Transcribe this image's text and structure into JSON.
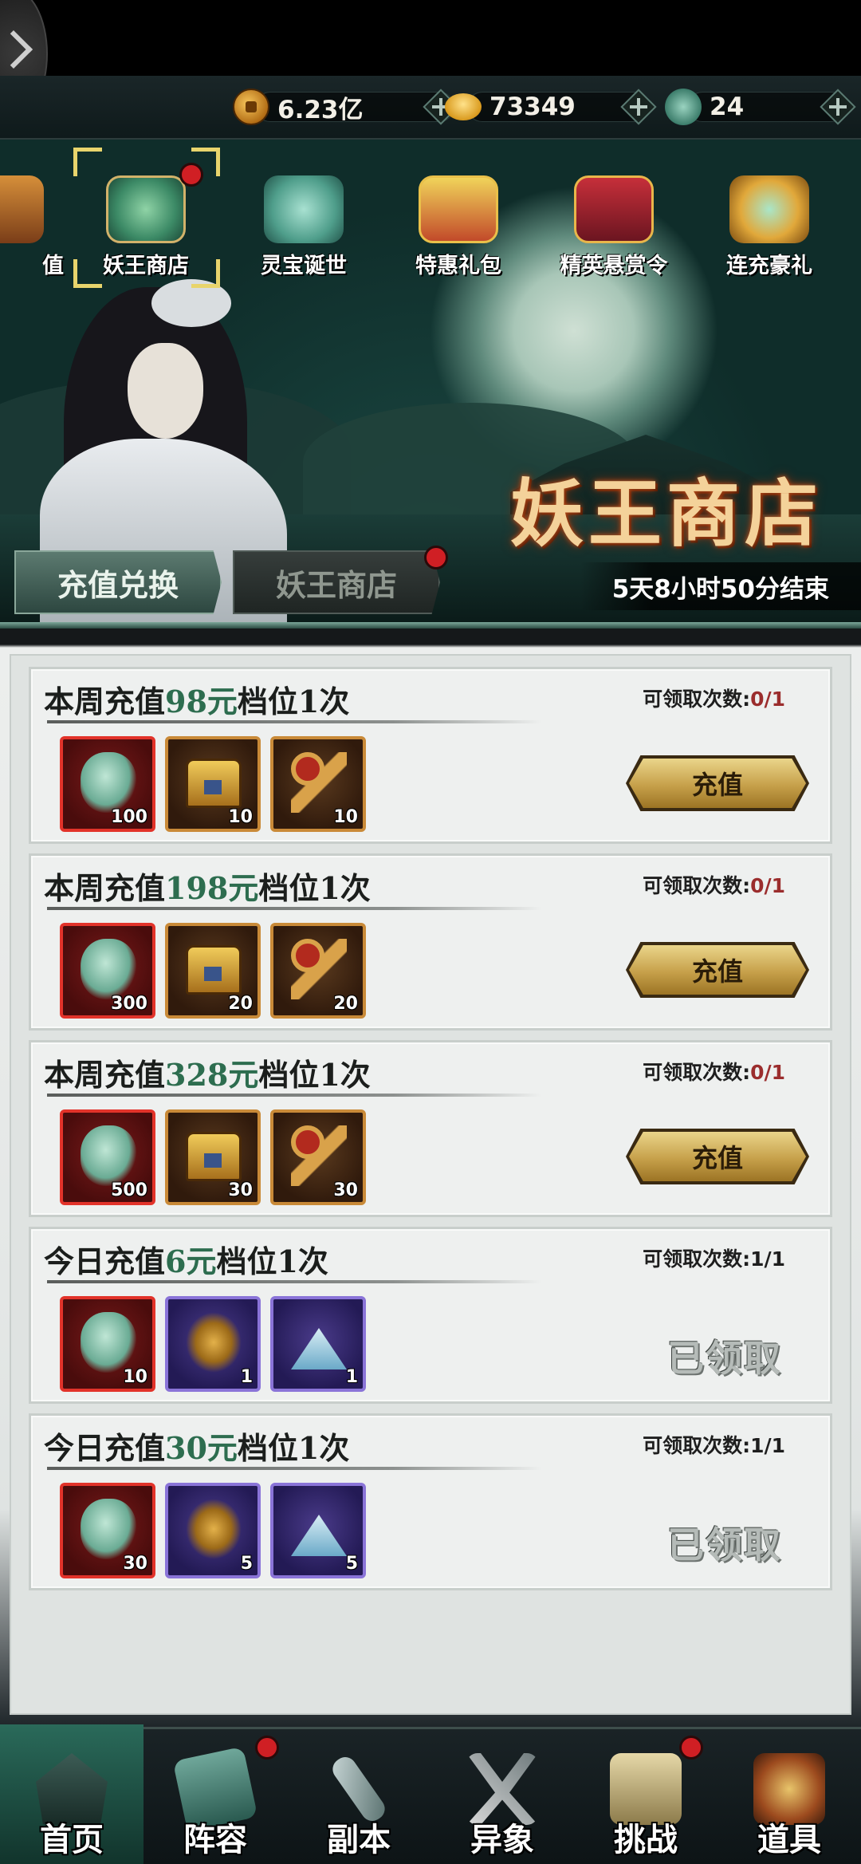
{
  "currency": {
    "gold": "6.23亿",
    "ingot": "73349",
    "jade": "24"
  },
  "shop_icons": [
    {
      "label": "值"
    },
    {
      "label": "妖王商店"
    },
    {
      "label": "灵宝诞世"
    },
    {
      "label": "特惠礼包"
    },
    {
      "label": "精英悬赏令"
    },
    {
      "label": "连充豪礼"
    }
  ],
  "banner": {
    "title": "妖王商店",
    "timer": "5天8小时50分结束"
  },
  "tabs": [
    {
      "label": "充值兑换"
    },
    {
      "label": "妖王商店"
    }
  ],
  "cards": [
    {
      "prefix": "本周充值",
      "amount": "98元",
      "suffix": "档位1次",
      "count_label": "可领取次数:",
      "count": "0/1",
      "rewards": [
        "100",
        "10",
        "10"
      ],
      "action": "充值"
    },
    {
      "prefix": "本周充值",
      "amount": "198元",
      "suffix": "档位1次",
      "count_label": "可领取次数:",
      "count": "0/1",
      "rewards": [
        "300",
        "20",
        "20"
      ],
      "action": "充值"
    },
    {
      "prefix": "本周充值",
      "amount": "328元",
      "suffix": "档位1次",
      "count_label": "可领取次数:",
      "count": "0/1",
      "rewards": [
        "500",
        "30",
        "30"
      ],
      "action": "充值"
    },
    {
      "prefix": "今日充值",
      "amount": "6元",
      "suffix": "档位1次",
      "count_label": "可领取次数:",
      "count": "1/1",
      "rewards": [
        "10",
        "1",
        "1"
      ],
      "action": "已领取"
    },
    {
      "prefix": "今日充值",
      "amount": "30元",
      "suffix": "档位1次",
      "count_label": "可领取次数:",
      "count": "1/1",
      "rewards": [
        "30",
        "5",
        "5"
      ],
      "action": "已领取"
    }
  ],
  "bottom_nav": [
    {
      "label": "首页"
    },
    {
      "label": "阵容"
    },
    {
      "label": "副本"
    },
    {
      "label": "异象"
    },
    {
      "label": "挑战"
    },
    {
      "label": "道具"
    }
  ],
  "colors": {
    "amount_green": "#2d6d4f",
    "count_red": "#9b2d2d",
    "badge_red": "#d01f24",
    "button_gold": "#c6a04a"
  }
}
